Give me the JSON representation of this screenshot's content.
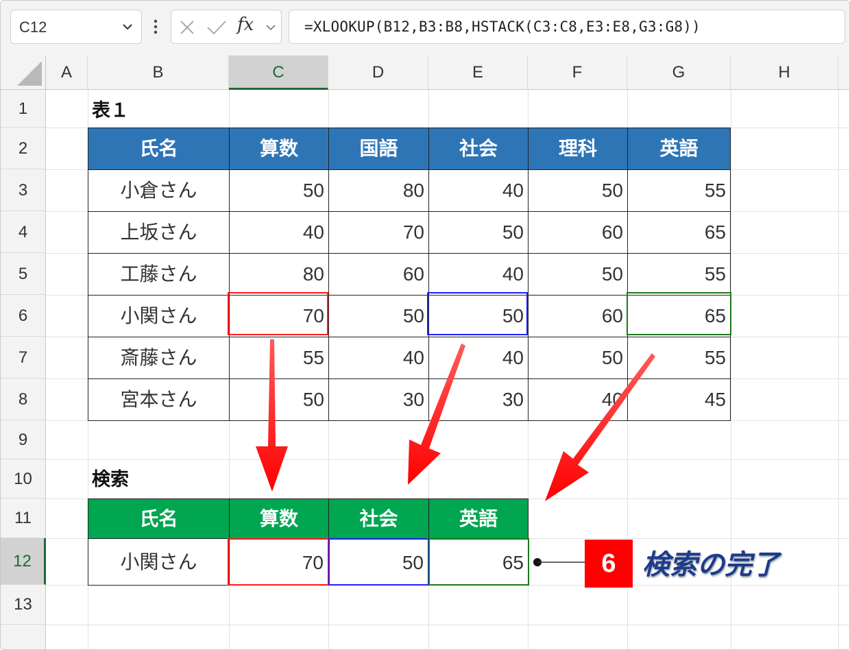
{
  "name_box": {
    "value": "C12"
  },
  "formula_bar": {
    "formula": "=XLOOKUP(B12,B3:B8,HSTACK(C3:C8,E3:E8,G3:G8))",
    "fx_label": "fx"
  },
  "columns": [
    "A",
    "B",
    "C",
    "D",
    "E",
    "F",
    "G",
    "H"
  ],
  "rows": [
    "1",
    "2",
    "3",
    "4",
    "5",
    "6",
    "7",
    "8",
    "9",
    "10",
    "11",
    "12",
    "13"
  ],
  "selected": {
    "column": "C",
    "row": "12"
  },
  "table1": {
    "title": "表１",
    "headers": [
      "氏名",
      "算数",
      "国語",
      "社会",
      "理科",
      "英語"
    ],
    "rows": [
      [
        "小倉さん",
        "50",
        "80",
        "40",
        "50",
        "55"
      ],
      [
        "上坂さん",
        "40",
        "70",
        "50",
        "60",
        "65"
      ],
      [
        "工藤さん",
        "80",
        "60",
        "40",
        "50",
        "55"
      ],
      [
        "小関さん",
        "70",
        "50",
        "50",
        "60",
        "65"
      ],
      [
        "斎藤さん",
        "55",
        "40",
        "40",
        "50",
        "55"
      ],
      [
        "宮本さん",
        "50",
        "30",
        "30",
        "40",
        "45"
      ]
    ]
  },
  "search": {
    "title": "検索",
    "headers": [
      "氏名",
      "算数",
      "社会",
      "英語"
    ],
    "row": [
      "小関さん",
      "70",
      "50",
      "65"
    ]
  },
  "annotation": {
    "step": "6",
    "text": "検索の完了"
  },
  "colors": {
    "table_header": "#2e75b6",
    "search_header": "#00a650",
    "highlight_red": "#ff1a1a",
    "highlight_blue": "#1f1fff",
    "highlight_green": "#1a7a1a",
    "arrow": "#ff0000",
    "callout_text": "#1f3a8a"
  }
}
